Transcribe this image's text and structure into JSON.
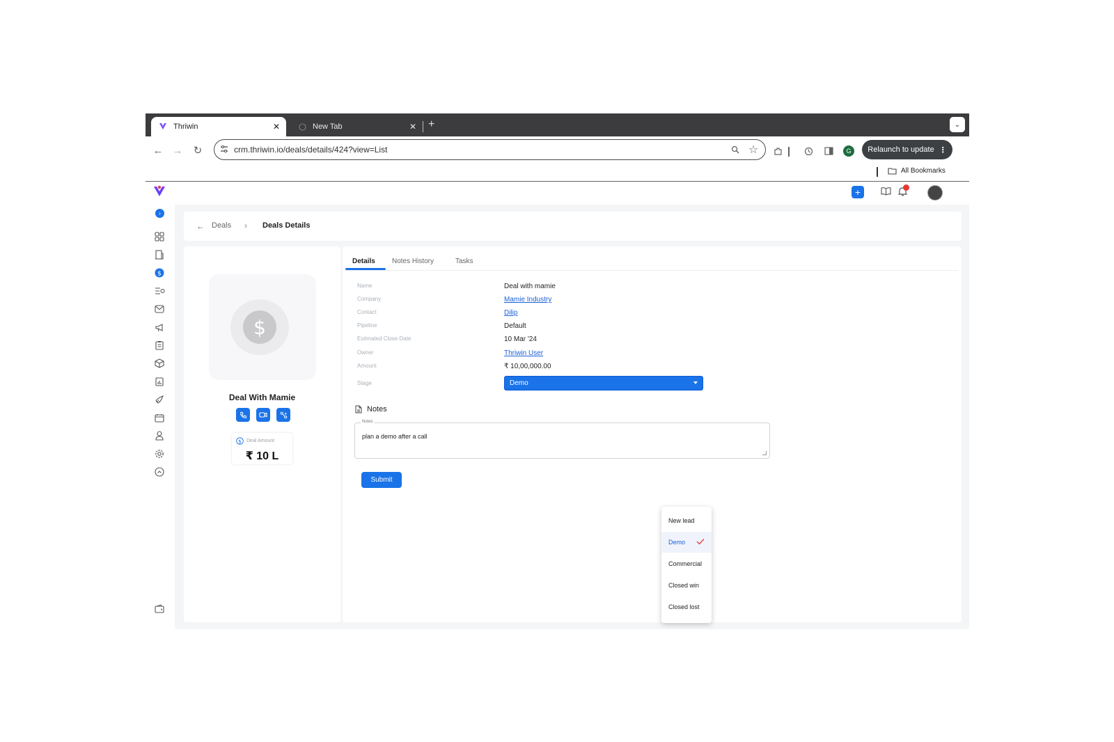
{
  "browser": {
    "tabs": [
      {
        "title": "Thriwin",
        "active": true
      },
      {
        "title": "New Tab",
        "active": false
      }
    ],
    "url": "crm.thriwin.io/deals/details/424?view=List",
    "profile_initial": "G",
    "relaunch_label": "Relaunch to update",
    "bookmarks_label": "All Bookmarks"
  },
  "breadcrumb": {
    "parent": "Deals",
    "current": "Deals Details"
  },
  "deal_card": {
    "title": "Deal With Mamie",
    "amount_label": "Deal Amount",
    "amount_value": "₹ 10 L"
  },
  "tabs": [
    {
      "label": "Details",
      "active": true
    },
    {
      "label": "Notes History",
      "active": false
    },
    {
      "label": "Tasks",
      "active": false
    }
  ],
  "fields": {
    "name": {
      "label": "Name",
      "value": "Deal with mamie"
    },
    "company": {
      "label": "Company",
      "value": "Mamie Industry"
    },
    "contact": {
      "label": "Contact",
      "value": "Dilip"
    },
    "pipeline": {
      "label": "Pipeline",
      "value": "Default"
    },
    "close_date": {
      "label": "Estimated Close Date",
      "value": "10 Mar '24"
    },
    "owner": {
      "label": "Owner",
      "value": "Thriwin User"
    },
    "amount": {
      "label": "Amount",
      "value": "₹ 10,00,000.00"
    },
    "stage": {
      "label": "Stage",
      "value": "Demo"
    }
  },
  "stage_options": [
    "New lead",
    "Demo",
    "Commercial",
    "Closed win",
    "Closed lost"
  ],
  "stage_selected": "Demo",
  "notes": {
    "heading": "Notes",
    "field_label": "Notes",
    "value": "plan a demo after a call"
  },
  "submit_label": "Submit",
  "colors": {
    "accent": "#1a73e8",
    "check": "#e53935"
  }
}
